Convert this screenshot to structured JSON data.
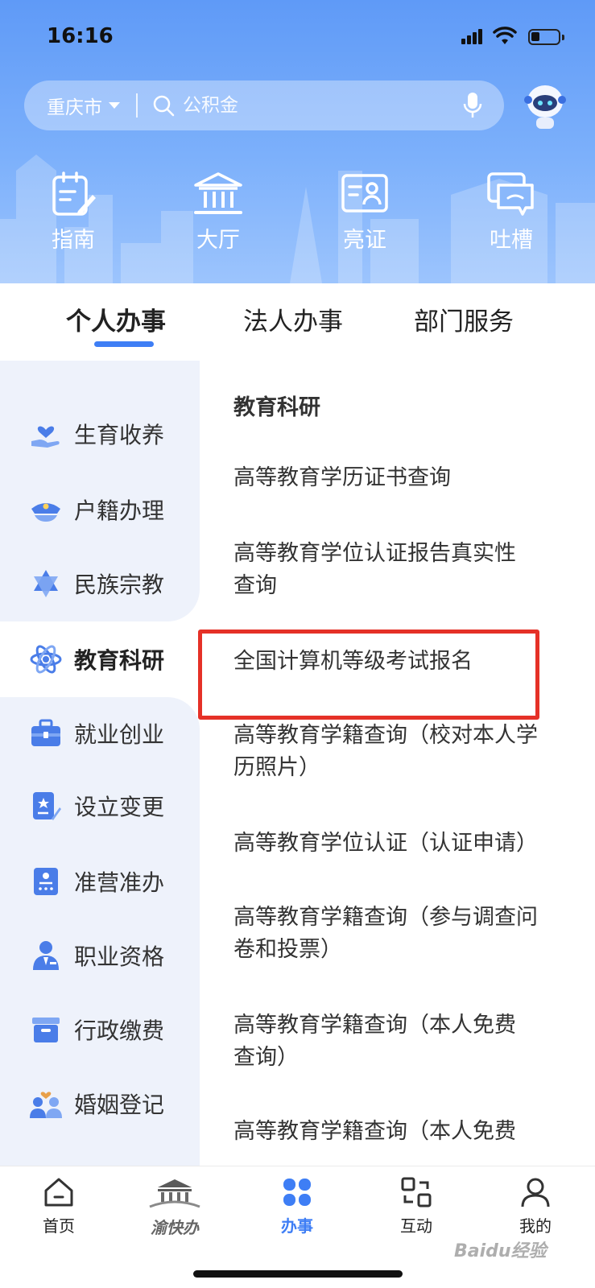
{
  "status_bar": {
    "time": "16:16"
  },
  "search": {
    "city": "重庆市",
    "placeholder": "公积金"
  },
  "quick_actions": [
    {
      "label": "指南",
      "icon": "guide-icon"
    },
    {
      "label": "大厅",
      "icon": "hall-icon"
    },
    {
      "label": "亮证",
      "icon": "id-card-icon"
    },
    {
      "label": "吐槽",
      "icon": "feedback-icon"
    }
  ],
  "tabs": [
    {
      "label": "个人办事",
      "active": true
    },
    {
      "label": "法人办事",
      "active": false
    },
    {
      "label": "部门服务",
      "active": false
    }
  ],
  "sidebar": {
    "items": [
      {
        "label": "生育收养",
        "icon": "hand-heart-icon"
      },
      {
        "label": "户籍办理",
        "icon": "police-cap-icon"
      },
      {
        "label": "民族宗教",
        "icon": "star-of-david-icon"
      },
      {
        "label": "教育科研",
        "icon": "atom-icon",
        "active": true
      },
      {
        "label": "就业创业",
        "icon": "briefcase-icon"
      },
      {
        "label": "设立变更",
        "icon": "document-pen-icon"
      },
      {
        "label": "准营准办",
        "icon": "license-icon"
      },
      {
        "label": "职业资格",
        "icon": "professional-icon"
      },
      {
        "label": "行政缴费",
        "icon": "archive-box-icon"
      },
      {
        "label": "婚姻登记",
        "icon": "couple-icon"
      }
    ]
  },
  "content": {
    "section_title": "教育科研",
    "services": [
      {
        "line1": "高等教育学历证书查询",
        "line2": ""
      },
      {
        "line1": "高等教育学位认证报告真实性",
        "line2": "查询"
      },
      {
        "line1": "全国计算机等级考试报名",
        "line2": ""
      },
      {
        "line1": "高等教育学籍查询（校对本人学",
        "line2": "历照片）"
      },
      {
        "line1": "高等教育学位认证（认证申请）",
        "line2": ""
      },
      {
        "line1": "高等教育学籍查询（参与调查问",
        "line2": "卷和投票）"
      },
      {
        "line1": "高等教育学籍查询（本人免费",
        "line2": "查询）"
      },
      {
        "line1": "高等教育学籍查询（本人免费",
        "line2": ""
      }
    ]
  },
  "bottom_nav": [
    {
      "label": "首页",
      "icon": "home-icon"
    },
    {
      "label": "渝快办",
      "icon": "yukuaiban-logo"
    },
    {
      "label": "办事",
      "icon": "grid-icon",
      "active": true
    },
    {
      "label": "互动",
      "icon": "interact-icon"
    },
    {
      "label": "我的",
      "icon": "user-icon"
    }
  ],
  "watermark": "Baidu经验",
  "colors": {
    "accent": "#3e7ef5",
    "highlight_border": "#e53127",
    "header_top": "#5f9af7"
  }
}
